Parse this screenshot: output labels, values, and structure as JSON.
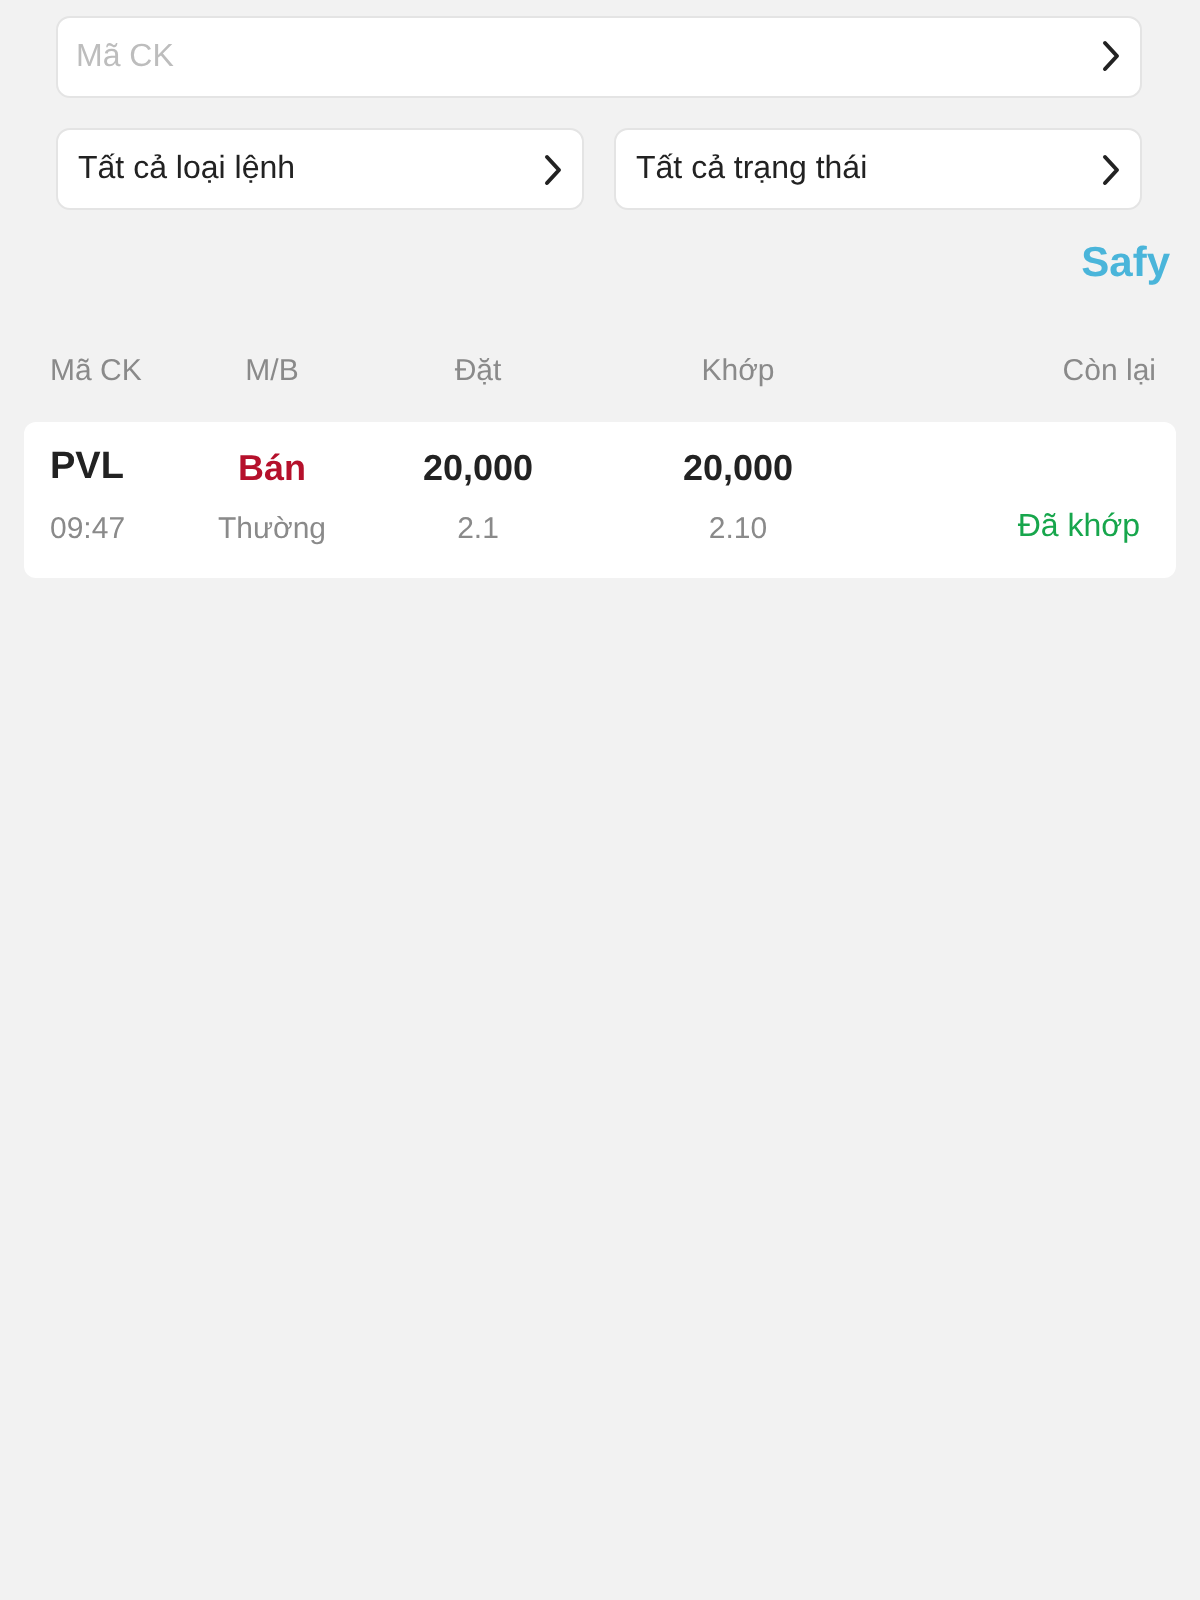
{
  "search": {
    "placeholder": "Mã CK"
  },
  "filters": [
    {
      "label": "Tất cả loại lệnh"
    },
    {
      "label": "Tất cả trạng thái"
    }
  ],
  "brand": "Safy",
  "table": {
    "columns": [
      "Mã CK",
      "M/B",
      "Đặt",
      "Khớp",
      "Còn lại"
    ],
    "rows": [
      {
        "symbol": "PVL",
        "time": "09:47",
        "side": {
          "label": "Bán",
          "kind": "sell"
        },
        "order_type": "Thường",
        "order_qty": "20,000",
        "order_price": "2.1",
        "matched_qty": "20,000",
        "matched_price": "2.10",
        "status": {
          "label": "Đã khớp",
          "kind": "matched"
        }
      }
    ]
  }
}
